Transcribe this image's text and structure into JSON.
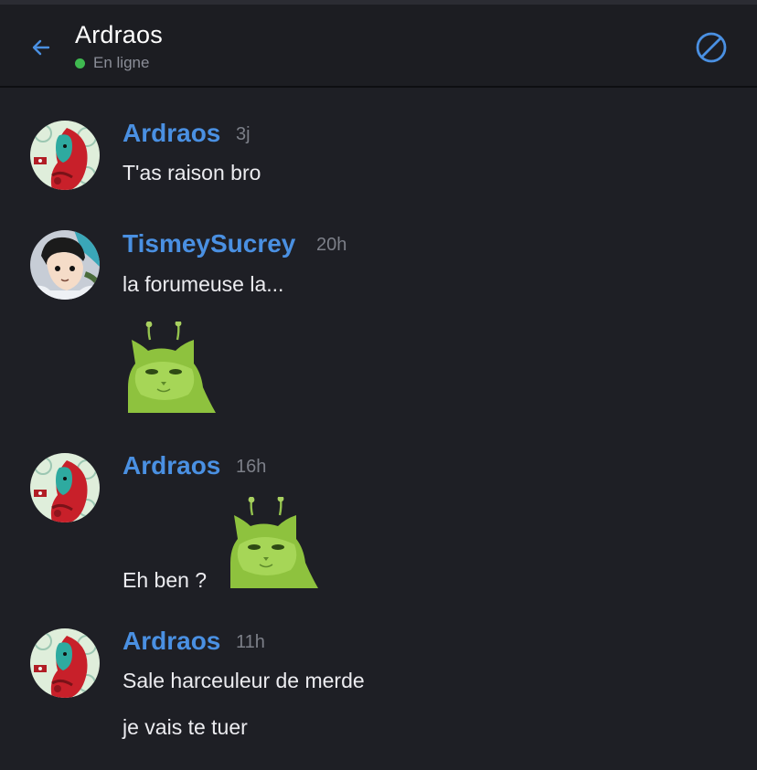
{
  "header": {
    "title": "Ardraos",
    "status": "En ligne",
    "status_color": "#3fb950",
    "back_icon": "arrow-left-icon",
    "block_icon": "block-icon"
  },
  "colors": {
    "accent": "#4a90e2",
    "background": "#1e1f25",
    "header_bg": "#1c1d22"
  },
  "messages": [
    {
      "author": "Ardraos",
      "time": "3j",
      "lines": [
        "T'as raison bro"
      ],
      "sticker": false,
      "avatar": "ardraos-avatar"
    },
    {
      "author": "TismeySucrey",
      "time": "20h",
      "lines": [
        "la forumeuse la..."
      ],
      "sticker": true,
      "sticker_name": "green-cat-sticker",
      "avatar": "tismey-avatar"
    },
    {
      "author": "Ardraos",
      "time": "16h",
      "lines": [
        "Eh ben ?"
      ],
      "sticker": true,
      "sticker_name": "green-cat-sticker",
      "avatar": "ardraos-avatar"
    },
    {
      "author": "Ardraos",
      "time": "11h",
      "lines": [
        "Sale harceuleur de merde",
        "je vais te tuer"
      ],
      "sticker": false,
      "avatar": "ardraos-avatar"
    }
  ]
}
